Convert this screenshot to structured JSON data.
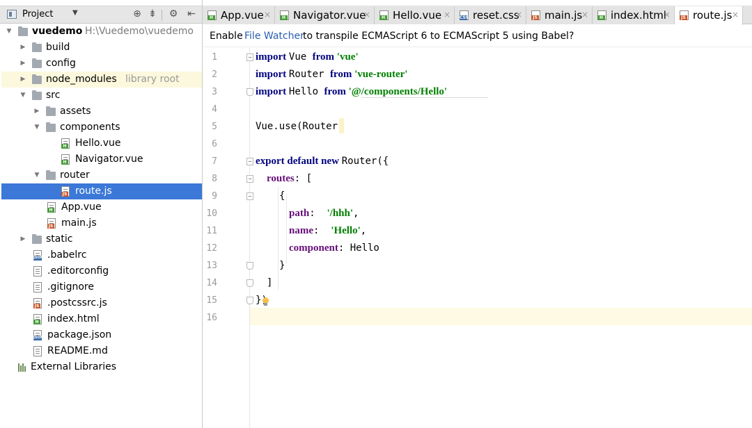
{
  "project_panel": {
    "title": "Project",
    "dropdown_icon": "chevron-down-icon",
    "tools": [
      "locate-icon",
      "collapse-icon",
      "gear-icon",
      "hide-panel-icon"
    ]
  },
  "tree": [
    {
      "label": "vuedemo",
      "hint": "H:\\Vuedemo\\vuedemo",
      "type": "folder",
      "depth": 0,
      "arrow": "down",
      "bold": true
    },
    {
      "label": "build",
      "type": "folder",
      "depth": 1,
      "arrow": "right"
    },
    {
      "label": "config",
      "type": "folder",
      "depth": 1,
      "arrow": "right"
    },
    {
      "label": "node_modules",
      "hint": "library root",
      "type": "folder",
      "depth": 1,
      "arrow": "right",
      "lib": true
    },
    {
      "label": "src",
      "type": "folder",
      "depth": 1,
      "arrow": "down"
    },
    {
      "label": "assets",
      "type": "folder",
      "depth": 2,
      "arrow": "right"
    },
    {
      "label": "components",
      "type": "folder",
      "depth": 2,
      "arrow": "down"
    },
    {
      "label": "Hello.vue",
      "type": "file",
      "badge": "H",
      "depth": 3
    },
    {
      "label": "Navigator.vue",
      "type": "file",
      "badge": "H",
      "depth": 3
    },
    {
      "label": "router",
      "type": "folder",
      "depth": 2,
      "arrow": "down"
    },
    {
      "label": "route.js",
      "type": "file",
      "badge": "JS",
      "depth": 3,
      "selected": true
    },
    {
      "label": "App.vue",
      "type": "file",
      "badge": "H",
      "depth": 2
    },
    {
      "label": "main.js",
      "type": "file",
      "badge": "JS",
      "depth": 2
    },
    {
      "label": "static",
      "type": "folder",
      "depth": 1,
      "arrow": "right"
    },
    {
      "label": ".babelrc",
      "type": "file",
      "badge": "JSON",
      "depth": 1
    },
    {
      "label": ".editorconfig",
      "type": "file",
      "badge": "",
      "depth": 1
    },
    {
      "label": ".gitignore",
      "type": "file",
      "badge": "",
      "depth": 1
    },
    {
      "label": ".postcssrc.js",
      "type": "file",
      "badge": "JS",
      "depth": 1
    },
    {
      "label": "index.html",
      "type": "file",
      "badge": "H",
      "depth": 1
    },
    {
      "label": "package.json",
      "type": "file",
      "badge": "JSON",
      "depth": 1
    },
    {
      "label": "README.md",
      "type": "file",
      "badge": "",
      "depth": 1
    },
    {
      "label": "External Libraries",
      "type": "libs",
      "depth": 0
    }
  ],
  "tabs": [
    {
      "label": "App.vue",
      "badge": "H",
      "close": "×"
    },
    {
      "label": "Navigator.vue",
      "badge": "H",
      "close": "×"
    },
    {
      "label": "Hello.vue",
      "badge": "H",
      "close": "×"
    },
    {
      "label": "reset.css",
      "badge": "CSS",
      "close": "×"
    },
    {
      "label": "main.js",
      "badge": "JS",
      "close": "×"
    },
    {
      "label": "index.html",
      "badge": "H",
      "close": "×"
    },
    {
      "label": "route.js",
      "badge": "JS",
      "close": "×",
      "active": true
    }
  ],
  "notice": {
    "prefix": "Enable",
    "link": "File Watcher",
    "suffix": "to transpile ECMAScript 6 to ECMAScript 5 using Babel?"
  },
  "editor": {
    "line_numbers": [
      "1",
      "2",
      "3",
      "4",
      "5",
      "6",
      "7",
      "8",
      "9",
      "10",
      "11",
      "12",
      "13",
      "14",
      "15",
      "16"
    ],
    "lines": [
      [
        [
          "kw",
          "import"
        ],
        [
          "",
          "Vue"
        ],
        [
          "kw",
          "from"
        ],
        [
          "str",
          "'vue'"
        ]
      ],
      [
        [
          "kw",
          "import"
        ],
        [
          "",
          "Router"
        ],
        [
          "kw",
          "from"
        ],
        [
          "str",
          "'vue-router'"
        ]
      ],
      [
        [
          "kw",
          "import"
        ],
        [
          "",
          "Hello"
        ],
        [
          "kw",
          "from"
        ],
        [
          "str",
          "'@/components/Hello'"
        ]
      ],
      [],
      [
        [
          "",
          "Vue.use(Router)"
        ]
      ],
      [],
      [
        [
          "kw",
          "export"
        ],
        [
          "kw",
          "default"
        ],
        [
          "kw",
          "new"
        ],
        [
          "",
          "Router({"
        ]
      ],
      [
        [
          "prop",
          "routes"
        ],
        [
          "",
          ": ["
        ]
      ],
      [
        [
          "",
          "{"
        ]
      ],
      [
        [
          "prop",
          "path"
        ],
        [
          "",
          ": "
        ],
        [
          "str",
          "'/hhh'"
        ],
        [
          "",
          ","
        ]
      ],
      [
        [
          "prop",
          "name"
        ],
        [
          "",
          ": "
        ],
        [
          "str",
          "'Hello'"
        ],
        [
          "",
          ","
        ]
      ],
      [
        [
          "prop",
          "component"
        ],
        [
          "",
          ": Hello"
        ]
      ],
      [
        [
          "",
          "}"
        ]
      ],
      [
        [
          "",
          "]"
        ]
      ],
      [
        [
          "",
          "})"
        ]
      ],
      []
    ]
  }
}
